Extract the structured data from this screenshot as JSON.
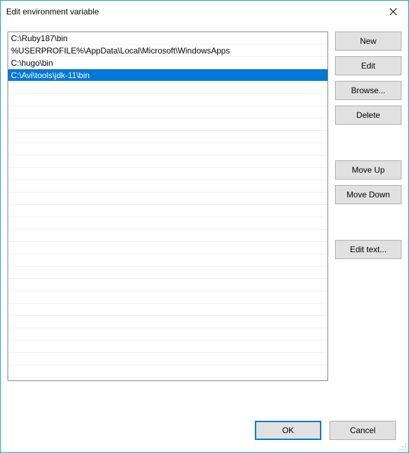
{
  "titlebar": {
    "title": "Edit environment variable"
  },
  "list": {
    "items": [
      {
        "value": "C:\\Ruby187\\bin",
        "selected": false
      },
      {
        "value": "%USERPROFILE%\\AppData\\Local\\Microsoft\\WindowsApps",
        "selected": false
      },
      {
        "value": "C:\\hugo\\bin",
        "selected": false
      },
      {
        "value": "C:\\Avi\\tools\\jdk-11\\bin",
        "selected": true
      }
    ]
  },
  "buttons": {
    "new": "New",
    "edit": "Edit",
    "browse": "Browse...",
    "delete": "Delete",
    "moveup": "Move Up",
    "movedown": "Move Down",
    "edittext": "Edit text...",
    "ok": "OK",
    "cancel": "Cancel"
  },
  "colors": {
    "selection": "#0078d7",
    "windowBorder": "#18a0d7",
    "buttonFace": "#e1e1e1",
    "buttonBorder": "#adadad"
  }
}
